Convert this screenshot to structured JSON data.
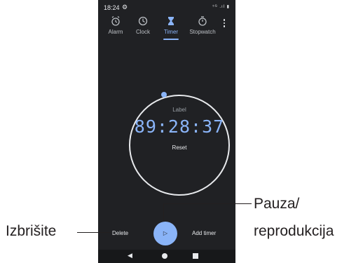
{
  "status": {
    "time": "18:24",
    "right_icons": "⁵ᴳ .ıl ▮"
  },
  "tabs": [
    {
      "label": "Alarm",
      "icon": "alarm-icon"
    },
    {
      "label": "Clock",
      "icon": "clock-icon"
    },
    {
      "label": "Timer",
      "icon": "hourglass-icon",
      "active": true
    },
    {
      "label": "Stopwatch",
      "icon": "stopwatch-icon"
    }
  ],
  "timer": {
    "label": "Label",
    "time": "89:28:37",
    "reset": "Reset"
  },
  "controls": {
    "delete": "Delete",
    "play_glyph": "▷",
    "add": "Add timer"
  },
  "navigation": {
    "back": "◀"
  },
  "callouts": {
    "left": "Izbrišite",
    "right_line1": "Pauza/",
    "right_line2": "reprodukcija"
  },
  "colors": {
    "background": "#202124",
    "accent": "#8ab4f8",
    "text": "#e8eaed"
  }
}
